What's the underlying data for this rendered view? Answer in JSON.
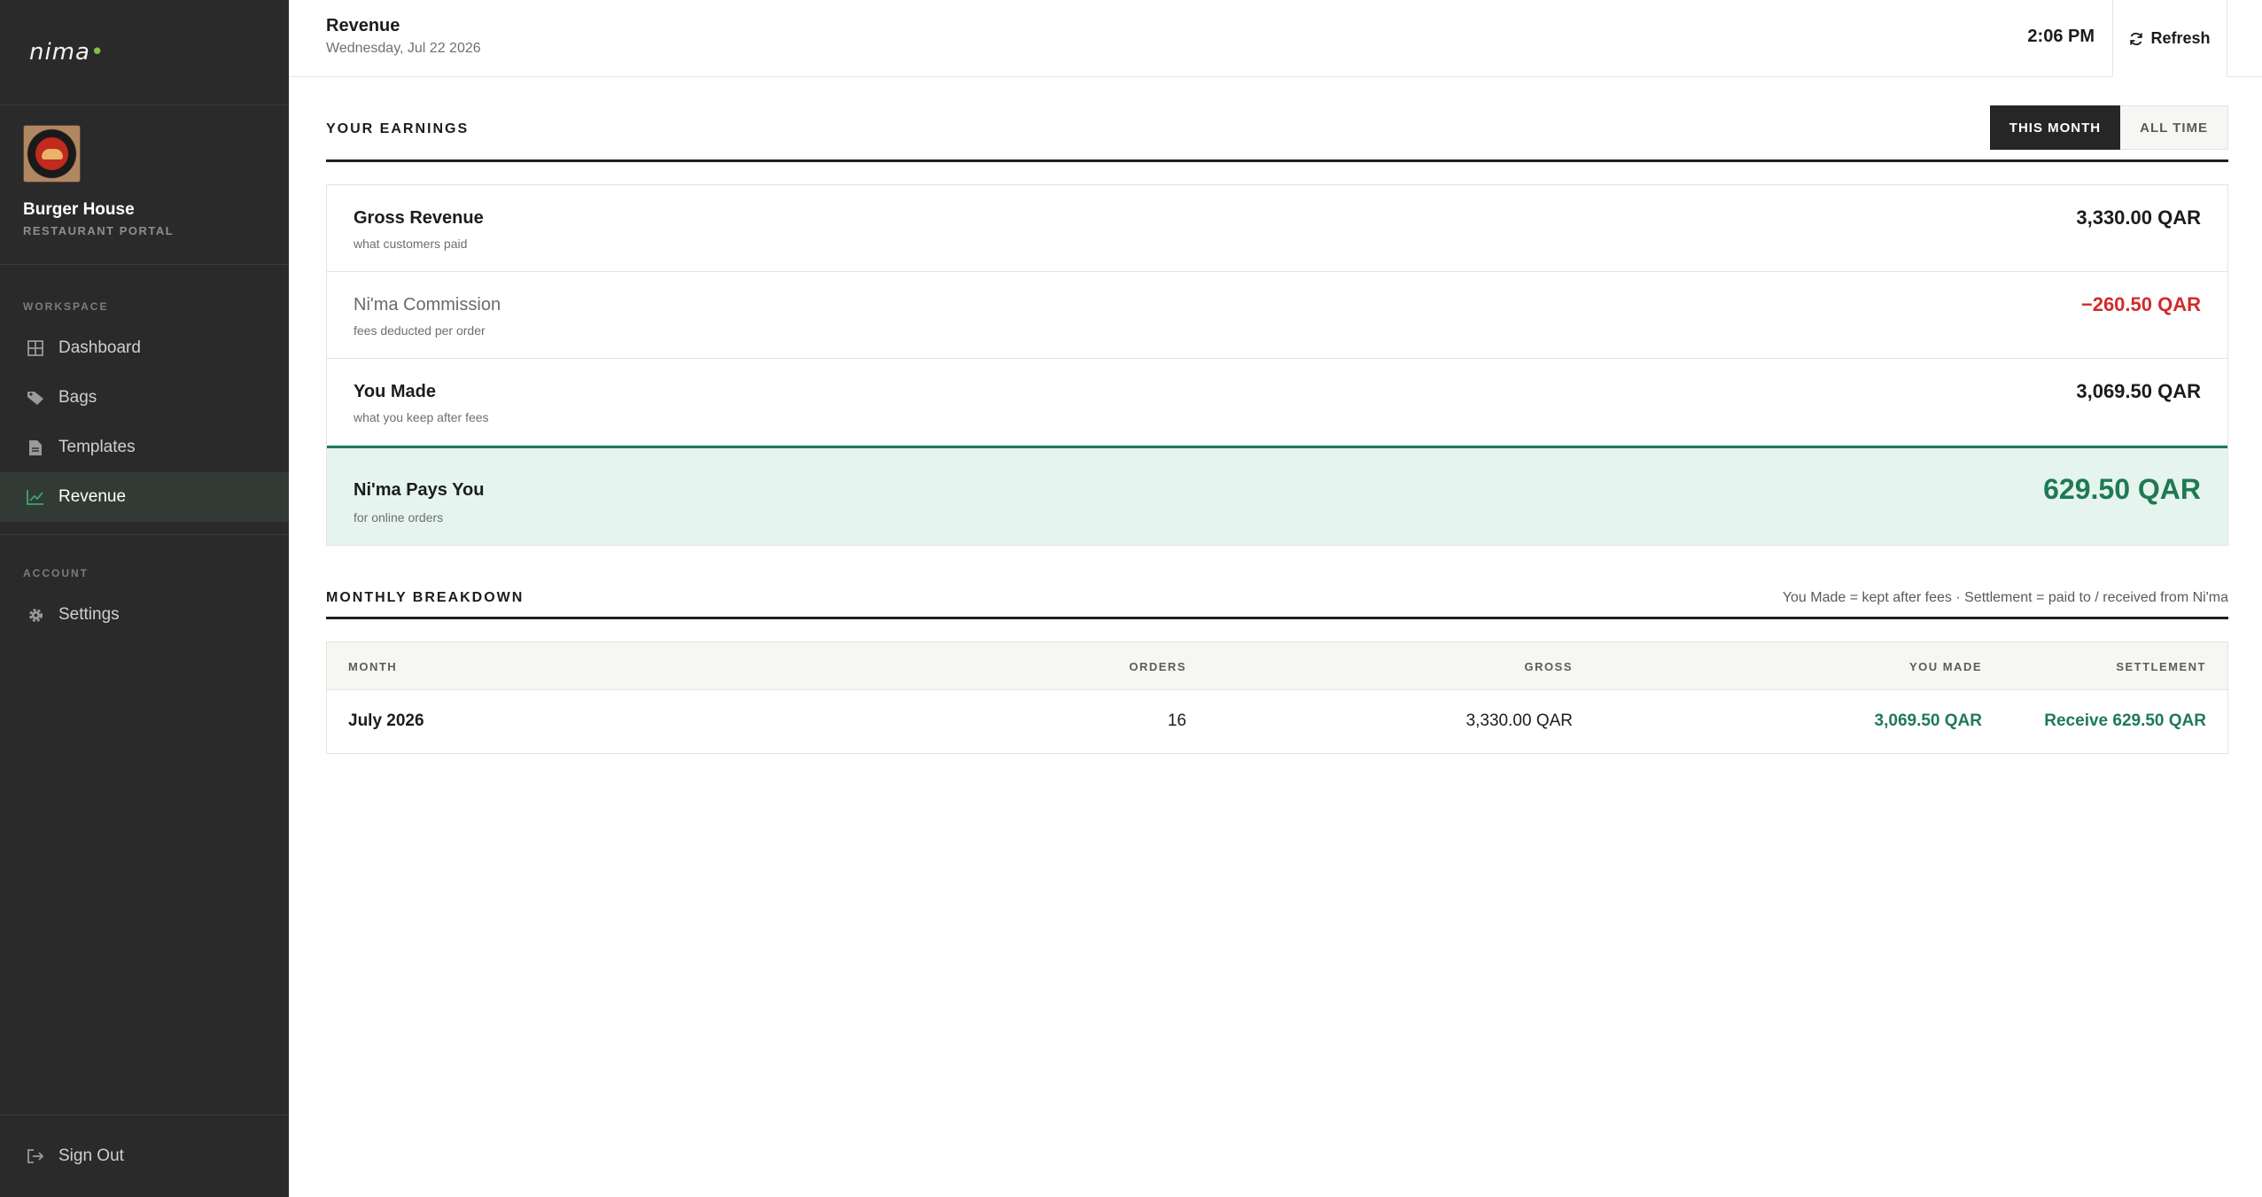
{
  "brand": {
    "logo_text": "nima",
    "accent": "#7fc241"
  },
  "profile": {
    "name": "Burger House",
    "subtitle": "RESTAURANT PORTAL"
  },
  "nav": {
    "workspace_label": "WORKSPACE",
    "items": [
      {
        "label": "Dashboard",
        "icon": "grid-icon"
      },
      {
        "label": "Bags",
        "icon": "tag-icon"
      },
      {
        "label": "Templates",
        "icon": "document-icon"
      },
      {
        "label": "Revenue",
        "icon": "chart-icon",
        "active": true
      }
    ],
    "account_label": "ACCOUNT",
    "account_items": [
      {
        "label": "Settings",
        "icon": "gear-icon"
      }
    ],
    "signout_label": "Sign Out"
  },
  "header": {
    "title": "Revenue",
    "date": "Wednesday, Jul 22 2026",
    "time": "2:06 PM",
    "refresh_label": "Refresh"
  },
  "earnings": {
    "section_title": "YOUR EARNINGS",
    "toggle": {
      "this_month": "THIS MONTH",
      "all_time": "ALL TIME",
      "selected": "this_month"
    },
    "rows": [
      {
        "label": "Gross Revenue",
        "sub": "what customers paid",
        "value": "3,330.00 QAR"
      },
      {
        "label": "Ni'ma Commission",
        "sub": "fees deducted per order",
        "value": "−260.50 QAR"
      },
      {
        "label": "You Made",
        "sub": "what you keep after fees",
        "value": "3,069.50 QAR"
      },
      {
        "label": "Ni'ma Pays You",
        "sub": "for online orders",
        "value": "629.50 QAR"
      }
    ],
    "colors": {
      "negative": "#d42a2a",
      "positive": "#1f7a54",
      "highlight_bg": "#e6f4ef"
    }
  },
  "breakdown": {
    "section_title": "MONTHLY BREAKDOWN",
    "note": "You Made = kept after fees · Settlement = paid to / received from Ni'ma",
    "columns": [
      "MONTH",
      "ORDERS",
      "GROSS",
      "YOU MADE",
      "SETTLEMENT"
    ],
    "rows": [
      {
        "month": "July 2026",
        "orders": "16",
        "gross": "3,330.00 QAR",
        "you_made": "3,069.50 QAR",
        "settlement": "Receive 629.50 QAR"
      }
    ]
  }
}
